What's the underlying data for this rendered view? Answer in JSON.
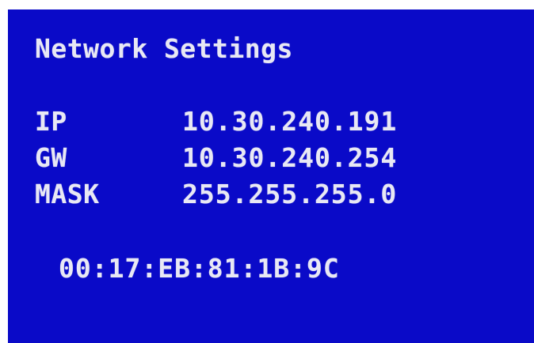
{
  "screen": {
    "title": "Network Settings",
    "background_color": "#0a0ac8",
    "text_color": "#e8e8f4"
  },
  "settings": {
    "ip": {
      "label": "IP",
      "value": "10.30.240.191"
    },
    "gw": {
      "label": "GW",
      "value": "10.30.240.254"
    },
    "mask": {
      "label": "MASK",
      "value": "255.255.255.0"
    }
  },
  "mac_address": "00:17:EB:81:1B:9C"
}
